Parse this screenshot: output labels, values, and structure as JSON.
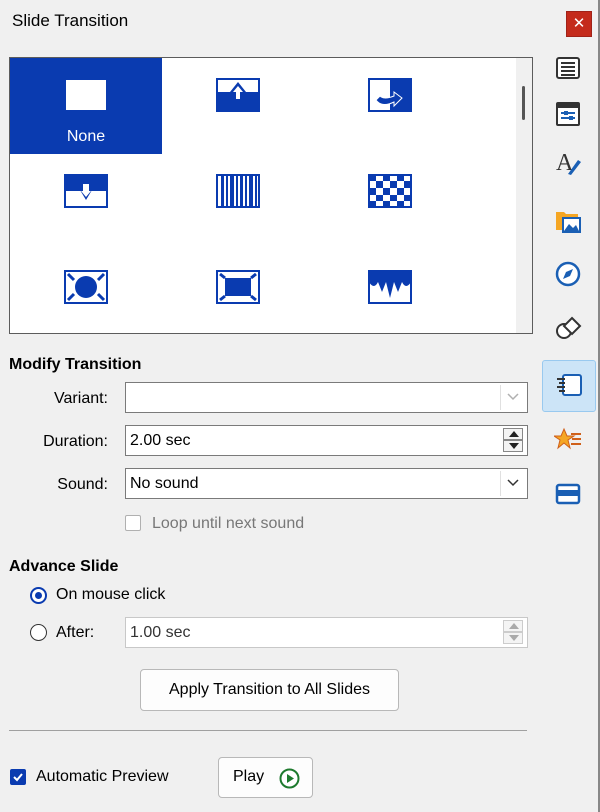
{
  "window": {
    "title": "Slide Transition",
    "close_glyph": "✕"
  },
  "gallery": {
    "items": [
      {
        "name": "none",
        "label": "None",
        "selected": true
      },
      {
        "name": "wipe-up"
      },
      {
        "name": "uncover"
      },
      {
        "name": "wipe-down"
      },
      {
        "name": "bars"
      },
      {
        "name": "checkers"
      },
      {
        "name": "shape-circle"
      },
      {
        "name": "box"
      },
      {
        "name": "fall"
      }
    ]
  },
  "modify": {
    "heading": "Modify Transition",
    "variant_label": "Variant:",
    "variant_value": "",
    "duration_label": "Duration:",
    "duration_value": "2.00 sec",
    "sound_label": "Sound:",
    "sound_value": "No sound",
    "loop_label": "Loop until next sound",
    "loop_checked": false
  },
  "advance": {
    "heading": "Advance Slide",
    "on_click_label": "On mouse click",
    "on_click_selected": true,
    "after_label": "After:",
    "after_value": "1.00 sec"
  },
  "apply_all_label": "Apply Transition to All Slides",
  "footer": {
    "auto_preview_label": "Automatic Preview",
    "auto_preview_checked": true,
    "play_label": "Play"
  },
  "sidebar": {
    "items": [
      {
        "icon": "properties-icon"
      },
      {
        "icon": "page-properties-icon"
      },
      {
        "icon": "styles-icon"
      },
      {
        "icon": "gallery-icon"
      },
      {
        "icon": "navigator-icon"
      },
      {
        "icon": "shapes-icon"
      },
      {
        "icon": "slide-transition-icon",
        "active": true
      },
      {
        "icon": "animation-icon"
      },
      {
        "icon": "master-slides-icon"
      }
    ]
  },
  "colors": {
    "accent": "#0a3bb0",
    "selection_bg": "#0a3bb0",
    "sidebar_active_bg": "#cce4f7"
  }
}
